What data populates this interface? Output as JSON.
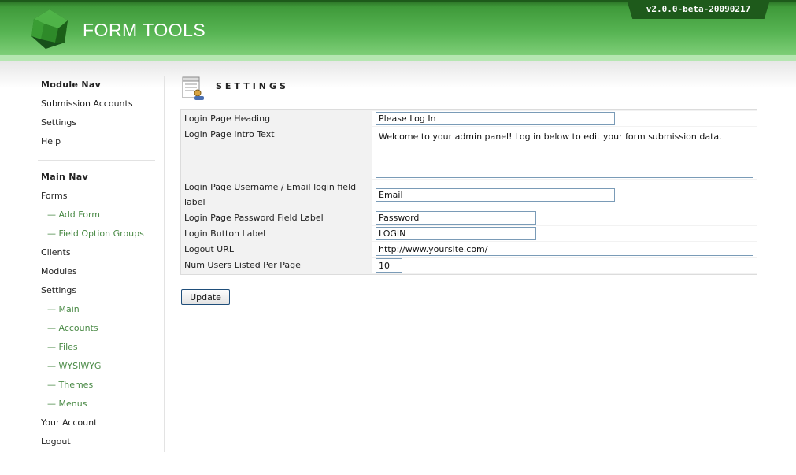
{
  "header": {
    "app_title": "FORM TOOLS",
    "version": "v2.0.0-beta-20090217"
  },
  "sidebar": {
    "module_nav": {
      "heading": "Module Nav",
      "items": [
        "Submission Accounts",
        "Settings",
        "Help"
      ]
    },
    "main_nav": {
      "heading": "Main Nav",
      "items": {
        "forms": "Forms",
        "add_form": "— Add Form",
        "field_option_groups": "— Field Option Groups",
        "clients": "Clients",
        "modules": "Modules",
        "settings": "Settings",
        "main": "— Main",
        "accounts": "— Accounts",
        "files": "— Files",
        "wysiwyg": "— WYSIWYG",
        "themes": "— Themes",
        "menus": "— Menus",
        "your_account": "Your Account",
        "logout": "Logout"
      }
    }
  },
  "main": {
    "title": "SETTINGS",
    "fields": {
      "heading": {
        "label": "Login Page Heading",
        "value": "Please Log In"
      },
      "intro": {
        "label": "Login Page Intro Text",
        "value": "Welcome to your admin panel! Log in below to edit your form submission data."
      },
      "username": {
        "label": "Login Page Username / Email login field label",
        "value": "Email"
      },
      "password": {
        "label": "Login Page Password Field Label",
        "value": "Password"
      },
      "button": {
        "label": "Login Button Label",
        "value": "LOGIN"
      },
      "logout_url": {
        "label": "Logout URL",
        "value": "http://www.yoursite.com/"
      },
      "num_users": {
        "label": "Num Users Listed Per Page",
        "value": "10"
      }
    },
    "update_label": "Update"
  },
  "colors": {
    "header_green": "#57b453",
    "header_dark": "#1e5a1b",
    "sub_link": "#4a8a46"
  }
}
